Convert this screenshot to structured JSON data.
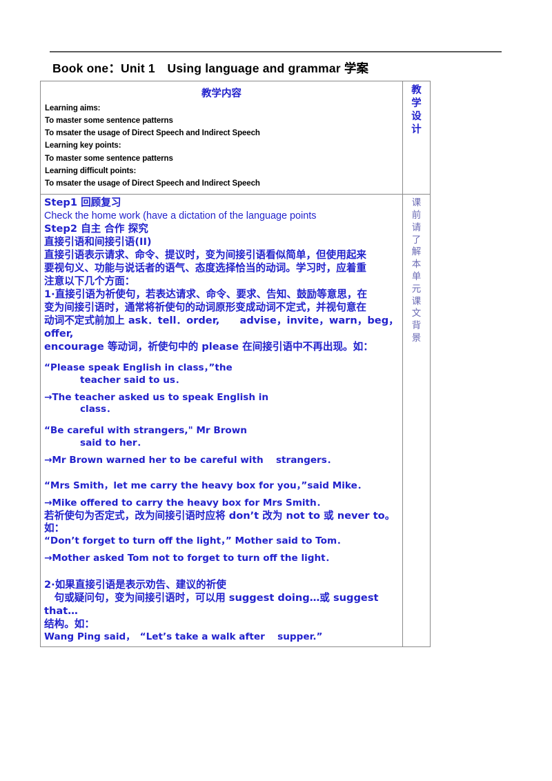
{
  "document": {
    "title": "Book one：Unit 1　Using language and grammar 学案"
  },
  "table": {
    "header": {
      "main_title": "教学内容",
      "side_title_chars": [
        "教",
        "学",
        "设",
        "计"
      ],
      "aims": [
        "Learning aims:",
        "To master some sentence patterns",
        "To msater the usage of Direct Speech and Indirect Speech",
        "Learning key points:",
        "To master some sentence patterns",
        "Learning difficult points:",
        "To msater the usage of Direct Speech and Indirect Speech"
      ]
    },
    "body": {
      "side_note_chars": [
        "课",
        "前",
        "请",
        "了",
        "解",
        "本",
        "单",
        "元",
        "课",
        "文",
        "背",
        "景"
      ],
      "lines": [
        {
          "id": "step1-heading",
          "text": "Step1  回顾复习",
          "style": "cn"
        },
        {
          "id": "step1-task",
          "text": "Check the home work (have a dictation of the language points",
          "style": "plainen"
        },
        {
          "id": "step2-heading",
          "text": "Step2  自主  合作  探究",
          "style": "cn"
        },
        {
          "id": "topic-heading",
          "text": "直接引语和间接引语(II)",
          "style": "cn"
        },
        {
          "id": "intro-1",
          "text": "直接引语表示请求、命令、提议时，变为间接引语看似简单，但使用起来",
          "style": "cn"
        },
        {
          "id": "intro-2",
          "text": "要视句义、功能与说话者的语气、态度选择恰当的动词。学习时，应着重",
          "style": "cn"
        },
        {
          "id": "intro-3",
          "text": "注意以下几个方面：",
          "style": "cn"
        },
        {
          "id": "point1-1",
          "text": "1·直接引语为祈使句，若表达请求、命令、要求、告知、鼓励等意思，在",
          "style": "cn"
        },
        {
          "id": "point1-2",
          "text": "变为间接引语时，通常将祈使句的动词原形变成动词不定式，并视句意在",
          "style": "cn"
        },
        {
          "id": "point1-3",
          "text": "动词不定式前加上 ask．tell．order,　　advise，invite，warn，beg，offer,",
          "style": "cn"
        },
        {
          "id": "point1-4",
          "text": "encourage 等动词，祈使句中的 please 在间接引语中不再出现。如：",
          "style": "cn"
        },
        {
          "id": "gap-a",
          "text": "",
          "style": "gap"
        },
        {
          "id": "ex1-quote",
          "text": "“Please speak English in class，”the",
          "style": "en"
        },
        {
          "id": "ex1-quote-2",
          "text": "teacher said to us．",
          "style": "en indent1"
        },
        {
          "id": "gap-b",
          "text": "",
          "style": "gap-sm"
        },
        {
          "id": "ex1-answer",
          "text": "→The teacher asked us to speak English in",
          "style": "en"
        },
        {
          "id": "ex1-answer-2",
          "text": "class．",
          "style": "en indent1"
        },
        {
          "id": "gap-c",
          "text": "",
          "style": "gap"
        },
        {
          "id": "ex2-quote",
          "text": "“Be careful with strangers,\" Mr Brown",
          "style": "en"
        },
        {
          "id": "ex2-quote-2",
          "text": "said to her．",
          "style": "en indent1"
        },
        {
          "id": "gap-d",
          "text": "",
          "style": "gap-sm"
        },
        {
          "id": "ex2-answer",
          "text": "→Mr Brown warned her to be careful with　 strangers．",
          "style": "en"
        },
        {
          "id": "gap-e",
          "text": "",
          "style": "gap-lg"
        },
        {
          "id": "ex3-quote",
          "text": "“Mrs Smith，let me carry the heavy box for you，”said Mike．",
          "style": "en"
        },
        {
          "id": "gap-f",
          "text": "",
          "style": "gap-sm"
        },
        {
          "id": "ex3-answer",
          "text": "→Mike offered to carry the heavy box for Mrs Smith．",
          "style": "en"
        },
        {
          "id": "neg-rule-1",
          "text": "若祈使句为否定式，改为间接引语时应将 don’t 改为 not  to 或 never  to。",
          "style": "cn"
        },
        {
          "id": "neg-rule-2",
          "text": "如：",
          "style": "cn"
        },
        {
          "id": "ex4-quote",
          "text": "“Don’t forget to turn off the light，” Mother said to Tom．",
          "style": "en"
        },
        {
          "id": "gap-g",
          "text": "",
          "style": "gap-sm"
        },
        {
          "id": "ex4-answer",
          "text": "→Mother asked Tom not to forget to turn off the light．",
          "style": "en"
        },
        {
          "id": "gap-h",
          "text": "",
          "style": "gap-lg"
        },
        {
          "id": "point2-1",
          "text": "2·如果直接引语是表示劝告、建议的祈使",
          "style": "cn"
        },
        {
          "id": "point2-2",
          "text": "　句或疑问句，变为间接引语时，可以用 suggest doing…或 suggest that…",
          "style": "cn"
        },
        {
          "id": "point2-3",
          "text": "结构。如：",
          "style": "cn"
        },
        {
          "id": "ex5-quote",
          "text": "Wang Ping said，　“Let’s take a walk after　 supper.”",
          "style": "en"
        }
      ]
    }
  },
  "colors": {
    "text_blue": "#2222cc",
    "side_note": "#6a6ab4",
    "border": "#8a8a8a",
    "rule": "#5a5a5a"
  }
}
